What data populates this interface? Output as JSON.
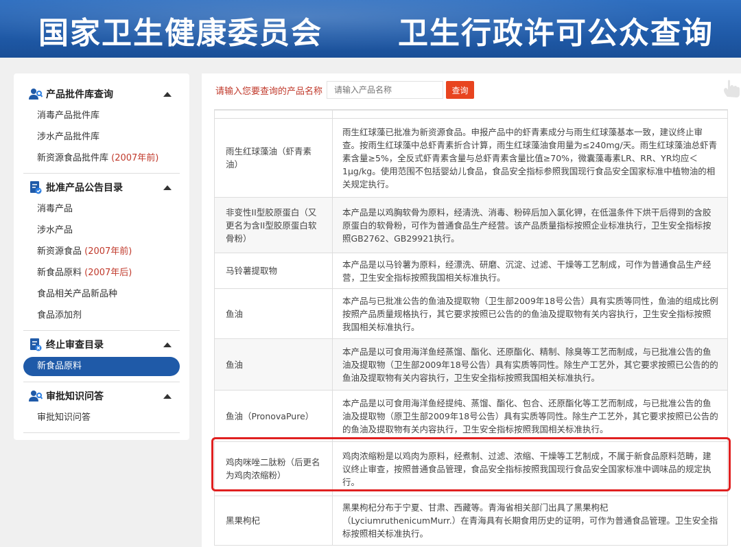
{
  "banner": {
    "left_title": "国家卫生健康委员会",
    "right_title": "卫生行政许可公众查询"
  },
  "sidebar": {
    "sections": [
      {
        "title": "产品批件库查询",
        "icon": "people-search-icon",
        "items": [
          {
            "label": "消毒产品批件库",
            "suffix": ""
          },
          {
            "label": "涉水产品批件库",
            "suffix": ""
          },
          {
            "label": "新资源食品批件库",
            "suffix": "(2007年前)"
          }
        ]
      },
      {
        "title": "批准产品公告目录",
        "icon": "doc-check-icon",
        "items": [
          {
            "label": "消毒产品",
            "suffix": ""
          },
          {
            "label": "涉水产品",
            "suffix": ""
          },
          {
            "label": "新资源食品",
            "suffix": "(2007年前)"
          },
          {
            "label": "新食品原料",
            "suffix": "(2007年后)"
          },
          {
            "label": "食品相关产品新品种",
            "suffix": ""
          },
          {
            "label": "食品添加剂",
            "suffix": ""
          }
        ]
      },
      {
        "title": "终止审查目录",
        "icon": "doc-stop-icon",
        "items": [
          {
            "label": "新食品原料",
            "suffix": "",
            "active": true
          }
        ]
      },
      {
        "title": "审批知识问答",
        "icon": "people-qa-icon",
        "items": [
          {
            "label": "审批知识问答",
            "suffix": ""
          }
        ]
      }
    ]
  },
  "search": {
    "label": "请输入您要查询的产品名称",
    "placeholder": "请输入产品名称",
    "button": "查询"
  },
  "table": {
    "rows": [
      {
        "name": "雨生红球藻油（虾青素油）",
        "desc": "雨生红球藻已批准为新资源食品。申报产品中的虾青素成分与雨生红球藻基本一致，建议终止审查。按雨生红球藻中总虾青素折合计算，雨生红球藻油食用量为≤240mg/天。雨生红球藻油总虾青素含量≥5%，全反式虾青素含量与总虾青素含量比值≥70%，微囊藻毒素LR、RR、YR均应＜1μg/kg。使用范围不包括婴幼儿食品，食品安全指标参照我国现行食品安全国家标准中植物油的相关规定执行。"
      },
      {
        "name": "非变性II型胶原蛋白（又更名为含II型胶原蛋白软骨粉）",
        "desc": "本产品是以鸡胸软骨为原料，经清洗、消毒、粉碎后加入氯化钾，在低温条件下烘干后得到的含胶原蛋白的软骨粉，可作为普通食品生产经营。该产品质量指标按照企业标准执行，卫生安全指标按照GB2762、GB29921执行。"
      },
      {
        "name": "马铃薯提取物",
        "desc": "本产品是以马铃薯为原料，经漂洗、研磨、沉淀、过滤、干燥等工艺制成，可作为普通食品生产经营，卫生安全指标按照我国相关标准执行。"
      },
      {
        "name": "鱼油",
        "desc": "本产品与已批准公告的鱼油及提取物（卫生部2009年18号公告）具有实质等同性，鱼油的组成比例按照产品质量规格执行，其它要求按照已公告的的鱼油及提取物有关内容执行，卫生安全指标按照我国相关标准执行。"
      },
      {
        "name": "鱼油",
        "desc": "本产品是以可食用海洋鱼经蒸馏、酯化、还原酯化、精制、除臭等工艺而制成，与已批准公告的鱼油及提取物（卫生部2009年18号公告）具有实质等同性。除生产工艺外，其它要求按照已公告的的鱼油及提取物有关内容执行，卫生安全指标按照我国相关标准执行。"
      },
      {
        "name": "鱼油（PronovaPure）",
        "desc": "本产品是以可食用海洋鱼经提纯、蒸馏、酯化、包合、还原酯化等工艺而制成，与已批准公告的鱼油及提取物（原卫生部2009年18号公告）具有实质等同性。除生产工艺外，其它要求按照已公告的的鱼油及提取物有关内容执行，卫生安全指标按照我国相关标准执行。"
      },
      {
        "name": "鸡肉咪唑二肽粉（后更名为鸡肉浓缩粉）",
        "desc": "鸡肉浓缩粉是以鸡肉为原料，经煮制、过滤、浓缩、干燥等工艺制成，不属于新食品原料范畴，建议终止审查，按照普通食品管理，食品安全指标按照我国现行食品安全国家标准中调味品的规定执行。"
      },
      {
        "name": "黑果枸杞",
        "desc": "黑果枸杞分布于宁夏、甘肃、西藏等。青海省相关部门出具了黑果枸杞（LyciumruthenicumMurr.）在青海具有长期食用历史的证明，可作为普通食品管理。卫生安全指标按照相关标准执行。"
      }
    ]
  }
}
